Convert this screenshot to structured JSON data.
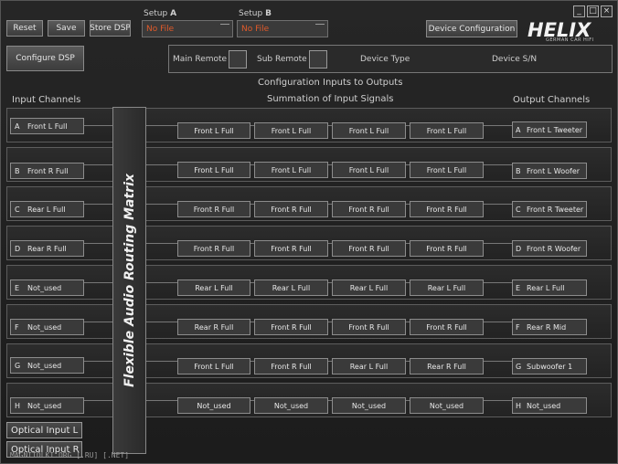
{
  "toolbar": {
    "reset": "Reset",
    "save": "Save",
    "store_dsp": "Store DSP",
    "configure_dsp": "Configure DSP",
    "device_configuration": "Device Configuration"
  },
  "setup_a": {
    "label_prefix": "Setup",
    "label_letter": "A",
    "value": "No File"
  },
  "setup_b": {
    "label_prefix": "Setup",
    "label_letter": "B",
    "value": "No File"
  },
  "window_controls": [
    "_",
    "□",
    "×"
  ],
  "logo": {
    "name": "HELIX",
    "tagline": "GERMAN CAR HIFI"
  },
  "remote_panel": {
    "main_remote": "Main Remote",
    "sub_remote": "Sub Remote",
    "device_type": "Device Type",
    "device_sn": "Device S/N"
  },
  "headings": {
    "title": "Configuration Inputs to Outputs",
    "inputs": "Input Channels",
    "summation": "Summation of Input Signals",
    "outputs": "Output Channels"
  },
  "matrix_label": "Flexible Audio Routing Matrix",
  "rows": [
    {
      "in_ch": "A",
      "in_name": "Front L Full",
      "sum": [
        "Front L Full",
        "Front L Full",
        "Front L Full",
        "Front L Full"
      ],
      "out_ch": "A",
      "out_name": "Front L Tweeter"
    },
    {
      "in_ch": "B",
      "in_name": "Front R Full",
      "sum": [
        "Front L Full",
        "Front L Full",
        "Front L Full",
        "Front L Full"
      ],
      "out_ch": "B",
      "out_name": "Front L Woofer"
    },
    {
      "in_ch": "C",
      "in_name": "Rear L Full",
      "sum": [
        "Front R Full",
        "Front R Full",
        "Front R Full",
        "Front R Full"
      ],
      "out_ch": "C",
      "out_name": "Front R Tweeter"
    },
    {
      "in_ch": "D",
      "in_name": "Rear R Full",
      "sum": [
        "Front R Full",
        "Front R Full",
        "Front R Full",
        "Front R Full"
      ],
      "out_ch": "D",
      "out_name": "Front R Woofer"
    },
    {
      "in_ch": "E",
      "in_name": "Not_used",
      "sum": [
        "Rear L Full",
        "Rear L Full",
        "Rear L Full",
        "Rear L Full"
      ],
      "out_ch": "E",
      "out_name": "Rear L Full"
    },
    {
      "in_ch": "F",
      "in_name": "Not_used",
      "sum": [
        "Rear R Full",
        "Front R Full",
        "Front R Full",
        "Front R Full"
      ],
      "out_ch": "F",
      "out_name": "Rear R Mid"
    },
    {
      "in_ch": "G",
      "in_name": "Not_used",
      "sum": [
        "Front L Full",
        "Front R Full",
        "Rear L Full",
        "Rear R Full"
      ],
      "out_ch": "G",
      "out_name": "Subwoofer 1"
    },
    {
      "in_ch": "H",
      "in_name": "Not_used",
      "sum": [
        "Not_used",
        "Not_used",
        "Not_used",
        "Not_used"
      ],
      "out_ch": "H",
      "out_name": "Not_used"
    }
  ],
  "optical": {
    "left": "Optical Input L",
    "right": "Optical Input R"
  },
  "watermark": "MAGNITOLKI.ORG [.RU] [.NET]"
}
